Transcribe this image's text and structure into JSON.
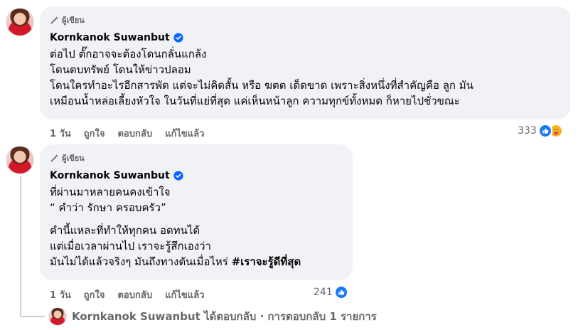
{
  "comment1": {
    "badge": "ผู้เขียน",
    "author": "Kornkanok Suwanbut",
    "lines": [
      "ต่อไป ตั๊กอาจจะต้องโดนกลั่นแกล้ง",
      "โดนตบทรัพย์ โดนให้ข่าวปลอม",
      "โดนใครทำอะไรอีกสารพัด แต่จะไม่คิดสั้น หรือ ฆตต เด็ดขาด เพราะสิ่งหนึ่งที่สำคัญคือ ลูก มัน",
      "เหมือนน้ำหล่อเลี้ยงหัวใจ ในวันที่แย่ที่สุด แค่เห็นหน้าลูก ความทุกข์ทั้งหมด ก็หายไปชั่วขณะ"
    ],
    "time": "1 วัน",
    "like": "ถูกใจ",
    "reply": "ตอบกลับ",
    "edited": "แก้ไขแล้ว",
    "reaction_count": "333",
    "reaction_icons": [
      "like-icon",
      "care-icon"
    ]
  },
  "comment2": {
    "badge": "ผู้เขียน",
    "author": "Kornkanok Suwanbut",
    "para1": [
      "ที่ผ่านมาหลายคนคงเข้าใจ",
      "“ คำว่า รักษา ครอบครัว”"
    ],
    "para2": [
      "คำนี้แหละที่ทำให้ทุกคน อดทนได้",
      "แต่เมื่อเวลาผ่านไป เราจะรู้สึกเองว่า",
      "มันไม่ได้แล้วจริงๆ มันถึงทางตันเมื่อไหร่ "
    ],
    "hashtag": "#เราจะรู้ดีที่สุด",
    "time": "1 วัน",
    "like": "ถูกใจ",
    "reply": "ตอบกลับ",
    "edited": "แก้ไขแล้ว",
    "reaction_count": "241",
    "reaction_icons": [
      "like-icon"
    ]
  },
  "reply_summary": {
    "text": "Kornkanok Suwanbut ได้ตอบกลับ · การตอบกลับ 1 รายการ"
  },
  "colors": {
    "bubble": "#f0f2f5",
    "secondary_text": "#65676b",
    "like_blue": "#1877f2",
    "verified_blue": "#0866ff"
  }
}
